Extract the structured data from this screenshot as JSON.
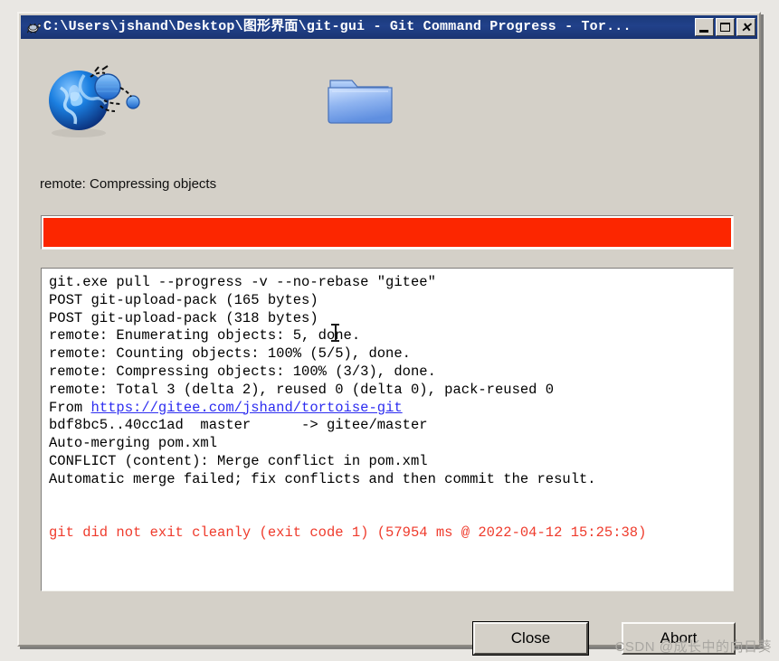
{
  "window": {
    "title": "C:\\Users\\jshand\\Desktop\\图形界面\\git-gui - Git Command Progress - Tor...",
    "icon": "tortoise-git-icon",
    "buttons": {
      "minimize": "minimize-button",
      "maximize": "maximize-button",
      "close": "close-button",
      "close_glyph": "✕"
    }
  },
  "icons": {
    "globe": "network-globe-icon",
    "folder": "open-folder-icon"
  },
  "status": {
    "label": "remote: Compressing objects"
  },
  "progress": {
    "percent": 100,
    "fill_color": "#fc2600",
    "track_color": "#ffffff"
  },
  "console": {
    "lines": [
      {
        "text": "git.exe pull --progress -v --no-rebase \"gitee\"",
        "style": "normal"
      },
      {
        "text": "POST git-upload-pack (165 bytes)",
        "style": "normal"
      },
      {
        "text": "POST git-upload-pack (318 bytes)",
        "style": "normal"
      },
      {
        "text": "remote: Enumerating objects: 5, done.",
        "style": "normal"
      },
      {
        "text": "remote: Counting objects: 100% (5/5), done.",
        "style": "normal"
      },
      {
        "text": "remote: Compressing objects: 100% (3/3), done.",
        "style": "normal"
      },
      {
        "text": "remote: Total 3 (delta 2), reused 0 (delta 0), pack-reused 0",
        "style": "normal"
      },
      {
        "text": "From ",
        "link": "https://gitee.com/jshand/tortoise-git",
        "style": "link"
      },
      {
        "text": "bdf8bc5..40cc1ad  master      -> gitee/master",
        "style": "normal"
      },
      {
        "text": "Auto-merging pom.xml",
        "style": "normal"
      },
      {
        "text": "CONFLICT (content): Merge conflict in pom.xml",
        "style": "normal"
      },
      {
        "text": "Automatic merge failed; fix conflicts and then commit the result.",
        "style": "normal"
      },
      {
        "text": "",
        "style": "blank"
      },
      {
        "text": "",
        "style": "blank"
      },
      {
        "text": "git did not exit cleanly (exit code 1) (57954 ms @ 2022-04-12 15:25:38)",
        "style": "error"
      }
    ],
    "error_color": "#ef3b2c",
    "link_color": "#2d2df0"
  },
  "footer": {
    "close_label": "Close",
    "abort_label": "Abort"
  },
  "watermark": {
    "text": "CSDN @成长中的向日葵"
  }
}
